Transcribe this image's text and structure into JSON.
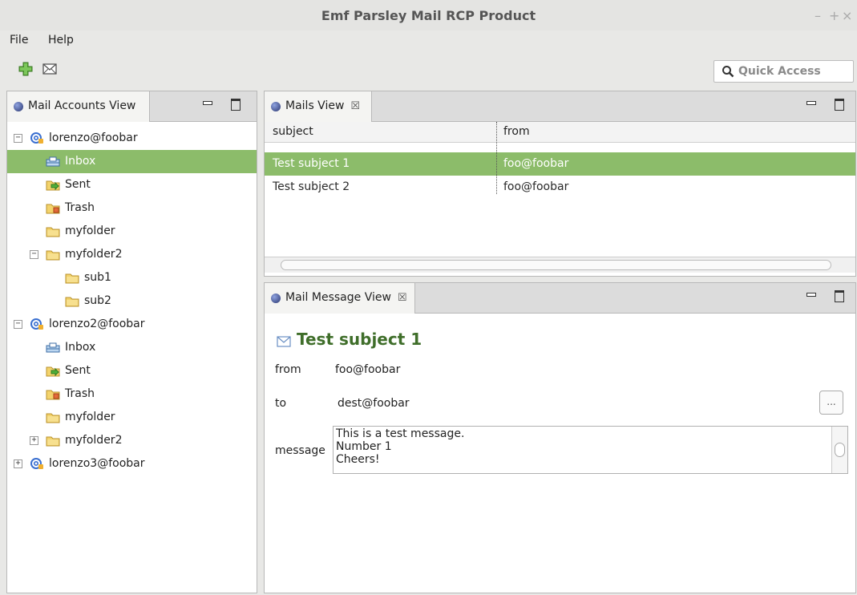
{
  "window": {
    "title": "Emf Parsley Mail RCP Product",
    "controls": {
      "minimize": "–",
      "maximize": "+",
      "close": "×"
    }
  },
  "menu": {
    "file": "File",
    "help": "Help"
  },
  "toolbar": {
    "new_icon": "plus-icon",
    "mail_icon": "mail-icon",
    "quick_access_placeholder": "Quick Access"
  },
  "accounts_view": {
    "tab_label": "Mail Accounts View",
    "accounts": [
      {
        "label": "lorenzo@foobar",
        "expander": "−",
        "folders": [
          {
            "label": "Inbox",
            "icon": "inbox-icon",
            "selected": true
          },
          {
            "label": "Sent",
            "icon": "sent-icon"
          },
          {
            "label": "Trash",
            "icon": "trash-icon"
          },
          {
            "label": "myfolder",
            "icon": "folder-icon"
          },
          {
            "label": "myfolder2",
            "icon": "folder-icon",
            "expander": "−",
            "children": [
              {
                "label": "sub1",
                "icon": "folder-icon"
              },
              {
                "label": "sub2",
                "icon": "folder-icon"
              }
            ]
          }
        ]
      },
      {
        "label": "lorenzo2@foobar",
        "expander": "−",
        "folders": [
          {
            "label": "Inbox",
            "icon": "inbox-icon"
          },
          {
            "label": "Sent",
            "icon": "sent-icon"
          },
          {
            "label": "Trash",
            "icon": "trash-icon"
          },
          {
            "label": "myfolder",
            "icon": "folder-icon"
          },
          {
            "label": "myfolder2",
            "icon": "folder-icon",
            "expander": "+"
          }
        ]
      },
      {
        "label": "lorenzo3@foobar",
        "expander": "+"
      }
    ]
  },
  "mails_view": {
    "tab_label": "Mails View",
    "close_glyph": "☒",
    "columns": [
      "subject",
      "from"
    ],
    "rows": [
      {
        "subject": "Test subject 1",
        "from": "foo@foobar",
        "selected": true
      },
      {
        "subject": "Test subject 2",
        "from": "foo@foobar"
      }
    ]
  },
  "message_view": {
    "tab_label": "Mail Message View",
    "close_glyph": "☒",
    "subject": "Test subject 1",
    "from_label": "from",
    "from_value": "foo@foobar",
    "to_label": "to",
    "to_value": "dest@foobar",
    "message_label": "message",
    "message_lines": [
      "This is a test message.",
      "Number 1",
      "Cheers!"
    ],
    "ellipsis_label": "..."
  },
  "colors": {
    "selection": "#8cbc6a",
    "subject_heading": "#3f6e2a"
  }
}
